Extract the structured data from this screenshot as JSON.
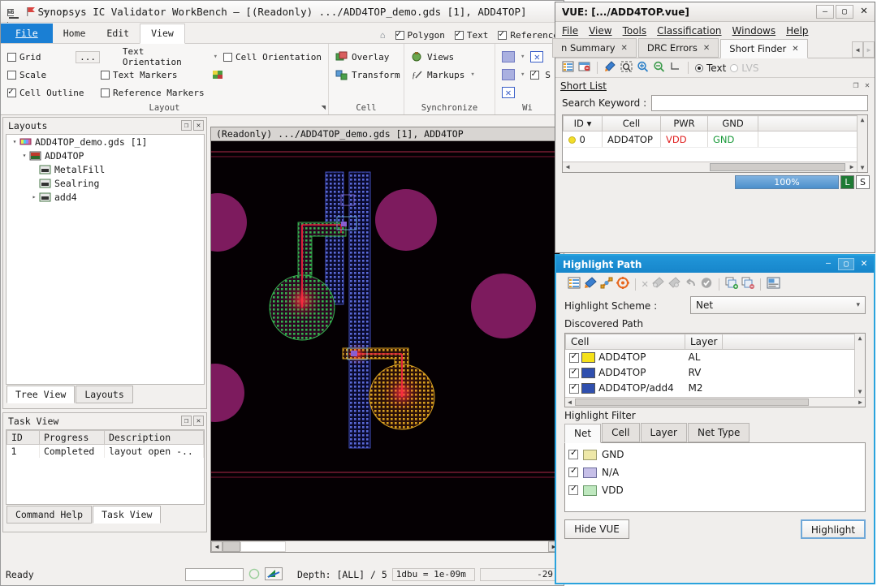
{
  "main_window": {
    "title": "Synopsys IC Validator WorkBench – [(Readonly) .../ADD4TOP_demo.gds [1], ADD4TOP]",
    "quick_access": [
      "wb-icon",
      "flag-icon",
      "redo-arrow-icon",
      "overflow-caret-icon"
    ],
    "ribbon_tabs": [
      {
        "label": "File",
        "state": "file"
      },
      {
        "label": "Home",
        "state": "normal"
      },
      {
        "label": "Edit",
        "state": "normal"
      },
      {
        "label": "View",
        "state": "active"
      }
    ],
    "ribbon_right_checks": [
      {
        "label": "Polygon",
        "checked": true
      },
      {
        "label": "Text",
        "checked": true
      },
      {
        "label": "Reference",
        "checked": true
      }
    ],
    "ribbon_groups": [
      {
        "name": "Layout",
        "checks": [
          {
            "label": "Grid",
            "checked": false
          },
          {
            "label": "Scale",
            "checked": false
          },
          {
            "label": "Cell Outline",
            "checked": true
          },
          {
            "label": "Text Markers",
            "checked": false
          },
          {
            "label": "Reference Markers",
            "checked": false
          },
          {
            "label": "Cell Orientation",
            "checked": false
          }
        ],
        "text_orientation_label": "Text Orientation",
        "grid_more_label": "..."
      },
      {
        "name": "Cell",
        "items": [
          {
            "label": "Overlay",
            "icon": "overlay-icon"
          },
          {
            "label": "Transform",
            "icon": "transform-icon"
          }
        ]
      },
      {
        "name": "Synchronize",
        "items": [
          {
            "label": "Views",
            "icon": "views-icon"
          },
          {
            "label": "Markups",
            "icon": "markups-icon"
          }
        ]
      },
      {
        "name": "Wi",
        "items": []
      }
    ],
    "layouts_panel": {
      "title": "Layouts",
      "tree": [
        {
          "label": "ADD4TOP_demo.gds [1]",
          "depth": 0,
          "twisty": "▾",
          "icon": "gds-file-icon"
        },
        {
          "label": "ADD4TOP",
          "depth": 1,
          "twisty": "▾",
          "icon": "topcell-icon"
        },
        {
          "label": "MetalFill",
          "depth": 2,
          "twisty": "",
          "icon": "cell-icon"
        },
        {
          "label": "Sealring",
          "depth": 2,
          "twisty": "",
          "icon": "cell-icon"
        },
        {
          "label": "add4",
          "depth": 2,
          "twisty": "▸",
          "icon": "cell-icon"
        }
      ],
      "tabs": [
        {
          "label": "Tree View",
          "active": true
        },
        {
          "label": "Layouts",
          "active": false
        }
      ]
    },
    "task_panel": {
      "title": "Task View",
      "columns": [
        "ID",
        "Progress",
        "Description"
      ],
      "rows": [
        [
          "1",
          "Completed",
          "layout open -.."
        ]
      ],
      "tabs": [
        {
          "label": "Command Help",
          "active": false
        },
        {
          "label": "Task View",
          "active": true
        }
      ]
    },
    "canvas": {
      "header": "(Readonly) .../ADD4TOP_demo.gds [1], ADD4TOP"
    },
    "statusbar": {
      "status": "Ready",
      "command_value": "",
      "depth": "Depth: [ALL] / 5",
      "dbu": "1dbu = 1e-09m",
      "coord": "-29"
    }
  },
  "vue_window": {
    "title": "VUE: [.../ADD4TOP.vue]",
    "window_buttons": [
      "minimize-icon",
      "maximize-icon",
      "close-icon"
    ],
    "menus": [
      "File",
      "View",
      "Tools",
      "Classification",
      "Windows",
      "Help"
    ],
    "tabs": [
      {
        "label": "n Summary",
        "active": false
      },
      {
        "label": "DRC Errors",
        "active": false
      },
      {
        "label": "Short Finder",
        "active": true
      }
    ],
    "toolbar_icons": [
      "list-icon",
      "report-icon",
      "pick-net-icon",
      "zoom-selection-icon",
      "zoom-in-icon",
      "zoom-out-icon",
      "measure-icon"
    ],
    "mode_radios": [
      {
        "label": "Text",
        "selected": true,
        "enabled": true
      },
      {
        "label": "LVS",
        "selected": false,
        "enabled": false
      }
    ],
    "short_list": {
      "title": "Short List",
      "search_label": "Search Keyword :",
      "search_value": "",
      "search_placeholder": "",
      "columns": [
        "ID",
        "Cell",
        "PWR",
        "GND",
        ""
      ],
      "rows": [
        {
          "marker": "#f2dd2a",
          "id": "0",
          "cell": "ADD4TOP",
          "pwr": "VDD",
          "gnd": "GND",
          "extra": ""
        }
      ],
      "progress_label": "100%",
      "badge_l": "L",
      "badge_s": "S"
    }
  },
  "highlight_path": {
    "title": "Highlight Path",
    "window_buttons": [
      "minimize-icon",
      "restore-icon",
      "close-icon"
    ],
    "toolbar_icons": [
      "list-icon",
      "pick-net-icon",
      "path-icon",
      "target-icon",
      "delete-icon",
      "remove-point-icon",
      "add-point-icon",
      "undo-icon",
      "accept-icon",
      "copy-add-icon",
      "copy-remove-icon",
      "snapshot-icon"
    ],
    "scheme_label": "Highlight Scheme :",
    "scheme_value": "Net",
    "scheme_options": [
      "Net"
    ],
    "discovered_path_label": "Discovered Path",
    "path_columns": [
      "Cell",
      "Layer",
      ""
    ],
    "path_rows": [
      {
        "checked": true,
        "color": "#f5e11a",
        "cell": "ADD4TOP",
        "layer": "AL"
      },
      {
        "checked": true,
        "color": "#2f4fae",
        "cell": "ADD4TOP",
        "layer": "RV"
      },
      {
        "checked": true,
        "color": "#2f4fae",
        "cell": "ADD4TOP/add4",
        "layer": "M2"
      }
    ],
    "filter_label": "Highlight Filter",
    "filter_tabs": [
      {
        "label": "Net",
        "active": true
      },
      {
        "label": "Cell",
        "active": false
      },
      {
        "label": "Layer",
        "active": false
      },
      {
        "label": "Net Type",
        "active": false
      }
    ],
    "filter_rows": [
      {
        "checked": true,
        "color": "#eee8a8",
        "label": "GND"
      },
      {
        "checked": true,
        "color": "#c6bfe8",
        "label": "N/A"
      },
      {
        "checked": true,
        "color": "#bfe8bf",
        "label": "VDD"
      }
    ],
    "hide_button": "Hide VUE",
    "highlight_button": "Highlight"
  },
  "colors": {
    "accent_blue": "#2196d9",
    "file_tab_blue": "#1a7fd4",
    "vdd_red": "#e02020",
    "gnd_green": "#1a9a3a",
    "canvas_bg": "#050003",
    "layer_purple": "#7d1b5e",
    "layer_blue": "#2f3fa8",
    "layer_yellow": "#d8a32a",
    "layer_green": "#2f9a4a",
    "layer_red": "#c02030"
  }
}
